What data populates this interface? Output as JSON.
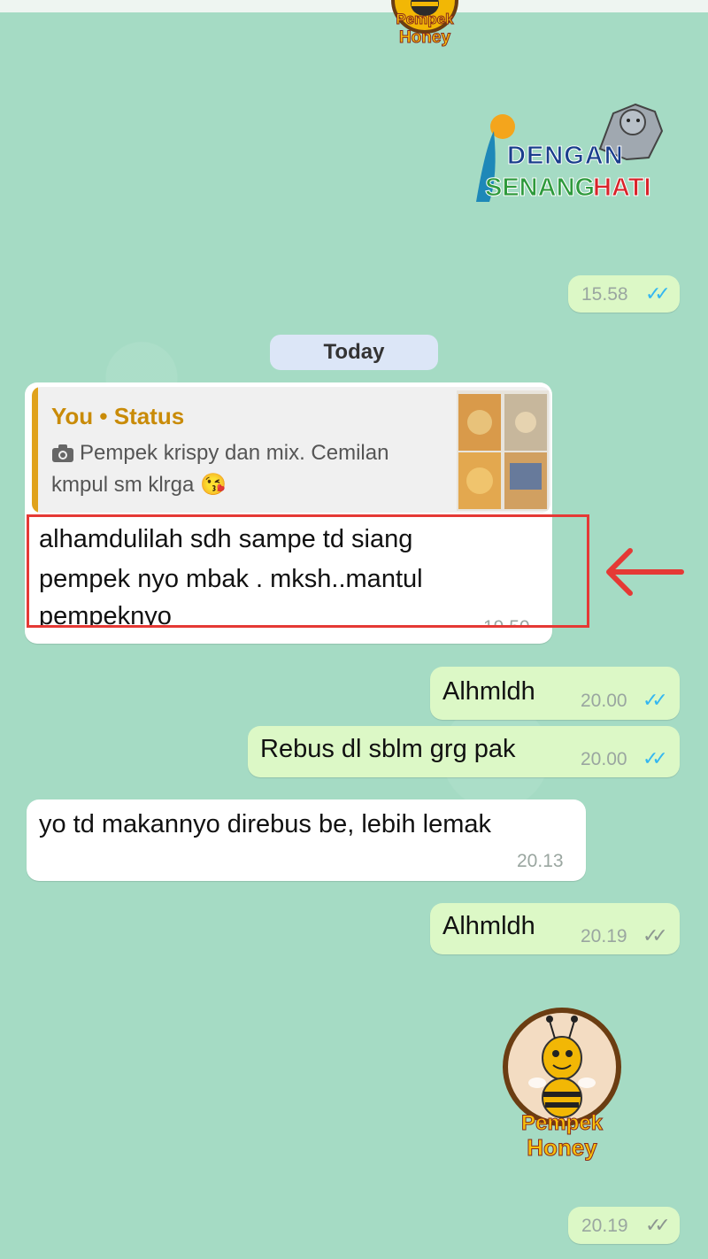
{
  "date_pill": "Today",
  "stickers": {
    "top_logo": {
      "line1": "Pempek",
      "line2": "Honey"
    },
    "dengan": {
      "line1": "DENGAN",
      "line2a": "SENANG",
      "line2b": "HATI"
    },
    "bottom_logo": {
      "line1": "Pempek",
      "line2": "Honey"
    }
  },
  "timestamps": {
    "sticker1": "15.58",
    "sticker2": "20.19"
  },
  "quote": {
    "title": "You • Status",
    "line1": "Pempek krispy dan mix. Cemilan",
    "line2": "kmpul sm klrga 😘",
    "camera_icon": "camera-icon"
  },
  "messages": [
    {
      "dir": "in",
      "lines": [
        "alhamdulilah sdh sampe td siang",
        "pempek nyo mbak . mksh..mantul",
        "pempeknyo"
      ],
      "time": "19.50"
    },
    {
      "dir": "out",
      "lines": [
        "Alhmldh"
      ],
      "time": "20.00",
      "ticks": "read"
    },
    {
      "dir": "out",
      "lines": [
        "Rebus dl sblm grg pak"
      ],
      "time": "20.00",
      "ticks": "read"
    },
    {
      "dir": "in",
      "lines": [
        "yo td makannyo direbus be, lebih lemak"
      ],
      "time": "20.13"
    },
    {
      "dir": "out",
      "lines": [
        "Alhmldh"
      ],
      "time": "20.19",
      "ticks": "delivered"
    }
  ],
  "colors": {
    "wallpaper": "#a5dbc4",
    "incoming_bubble": "#ffffff",
    "outgoing_bubble": "#dcf8c6",
    "read_ticks": "#34b7f1",
    "highlight": "#e53935",
    "quote_accent": "#e0a21c"
  }
}
